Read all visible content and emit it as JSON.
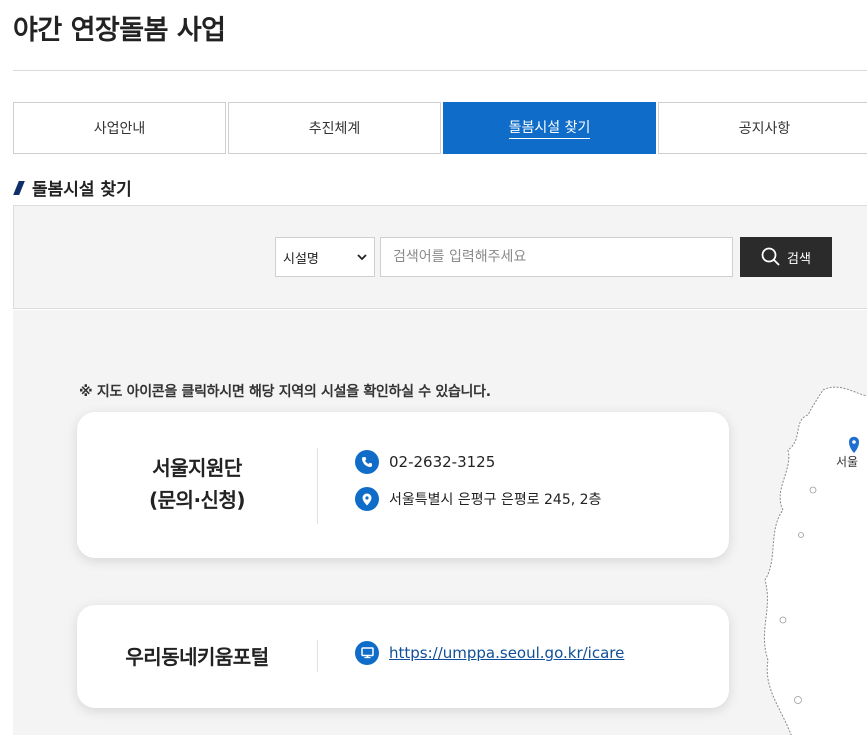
{
  "page": {
    "title": "야간 연장돌봄 사업"
  },
  "tabs": [
    {
      "label": "사업안내",
      "active": false
    },
    {
      "label": "추진체계",
      "active": false
    },
    {
      "label": "돌봄시설 찾기",
      "active": true
    },
    {
      "label": "공지사항",
      "active": false
    }
  ],
  "section": {
    "heading": "돌봄시설 찾기"
  },
  "search": {
    "select_value": "시설명",
    "placeholder": "검색어를 입력해주세요",
    "button_label": "검색"
  },
  "map": {
    "notice": "※ 지도 아이콘을 클릭하시면 해당 지역의 시설을 확인하실 수 있습니다.",
    "marker_label": "서울"
  },
  "cards": {
    "seoul_center": {
      "title_line1": "서울지원단",
      "title_line2": "(문의·신청)",
      "phone": "02-2632-3125",
      "address": "서울특별시 은평구 은평로 245, 2층"
    },
    "portal": {
      "title": "우리동네키움포털",
      "url": "https://umppa.seoul.go.kr/icare"
    }
  },
  "colors": {
    "accent": "#0f6cc9",
    "button_dark": "#2b2b2b",
    "panel_bg": "#f4f4f4"
  }
}
